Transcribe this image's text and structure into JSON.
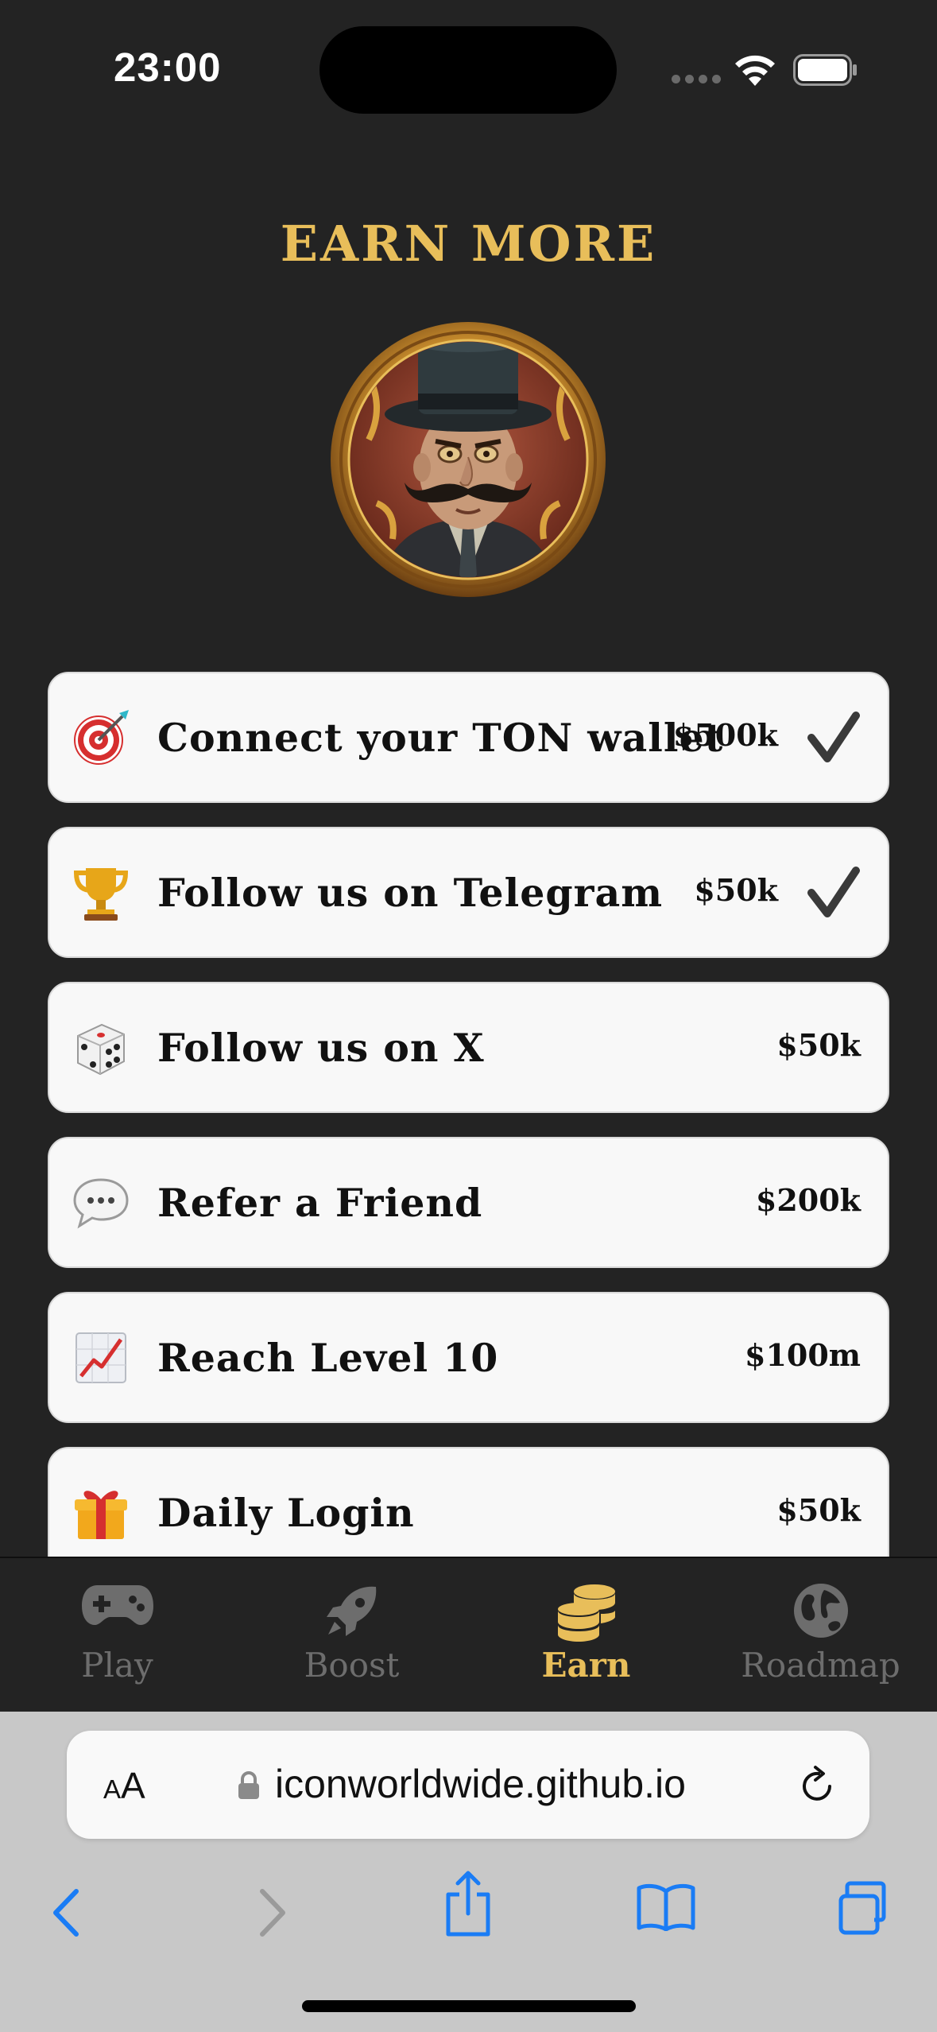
{
  "status_bar": {
    "time": "23:00",
    "icons": [
      "cellular-signal-icon",
      "wifi-icon",
      "battery-icon"
    ]
  },
  "header": {
    "title": "EARN MORE",
    "avatar": "mustache-gentleman-coin-avatar"
  },
  "tasks": [
    {
      "icon": "target-icon",
      "emoji": "🎯",
      "label": "Connect your TON wallet",
      "reward": "$500k",
      "completed": true
    },
    {
      "icon": "trophy-icon",
      "emoji": "🏆",
      "label": "Follow us on Telegram",
      "reward": "$50k",
      "completed": true
    },
    {
      "icon": "dice-icon",
      "emoji": "🎲",
      "label": "Follow us on X",
      "reward": "$50k",
      "completed": false
    },
    {
      "icon": "speech-bubble-icon",
      "emoji": "💬",
      "label": "Refer a Friend",
      "reward": "$200k",
      "completed": false
    },
    {
      "icon": "chart-increasing-icon",
      "emoji": "📈",
      "label": "Reach Level 10",
      "reward": "$100m",
      "completed": false
    },
    {
      "icon": "gift-icon",
      "emoji": "🎁",
      "label": "Daily Login",
      "reward": "$50k",
      "completed": false
    }
  ],
  "tabbar": {
    "items": [
      {
        "label": "Play",
        "icon": "gamepad-icon",
        "active": false
      },
      {
        "label": "Boost",
        "icon": "rocket-icon",
        "active": false
      },
      {
        "label": "Earn",
        "icon": "coins-icon",
        "active": true
      },
      {
        "label": "Roadmap",
        "icon": "globe-icon",
        "active": false
      }
    ]
  },
  "browser": {
    "aa_label": "AA",
    "url": "iconworldwide.github.io",
    "toolbar_icons": [
      "back-icon",
      "forward-icon",
      "share-icon",
      "bookmarks-icon",
      "tabs-icon"
    ]
  },
  "colors": {
    "background": "#232323",
    "accent": "#e8be5a",
    "card": "#f8f8f8",
    "tab_inactive": "#6d6d6d",
    "safari_blue": "#1a7cf5"
  }
}
